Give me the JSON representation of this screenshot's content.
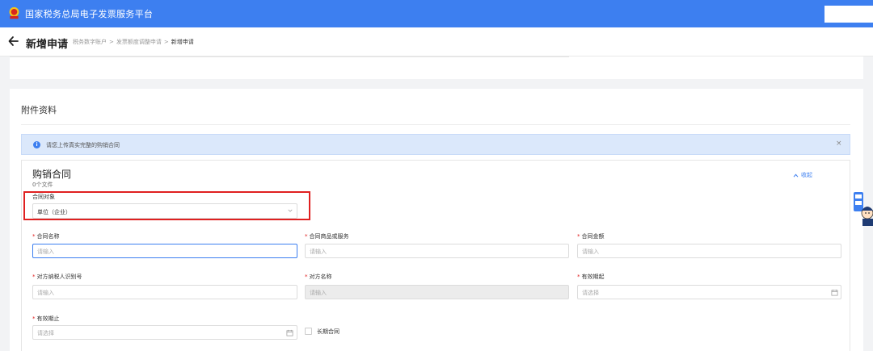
{
  "header": {
    "app_title": "国家税务总局电子发票服务平台"
  },
  "pagebar": {
    "title": "新增申请",
    "breadcrumb": [
      "税务数字账户",
      "发票额度调整申请",
      "新增申请"
    ],
    "separator": ">"
  },
  "section": {
    "title": "附件资料",
    "alert": {
      "text": "请您上传真实完整的购销合同",
      "close": "×"
    }
  },
  "contract": {
    "title": "购销合同",
    "file_count": "0个文件",
    "collapse_label": "收起",
    "object_label": "合同对象",
    "object_value": "单位（企业）"
  },
  "form": {
    "required_mark": "*",
    "name_label": "合同名称",
    "name_placeholder": "请输入",
    "goods_label": "合同商品或服务",
    "goods_placeholder": "请输入",
    "amount_label": "合同金额",
    "amount_placeholder": "请输入",
    "taxid_label": "对方纳税人识别号",
    "taxid_placeholder": "请输入",
    "party_label": "对方名称",
    "party_placeholder": "请输入",
    "start_label": "有效期起",
    "start_placeholder": "请选择",
    "end_label": "有效期止",
    "end_placeholder": "请选择",
    "longterm_label": "长期合同"
  },
  "colors": {
    "primary": "#3d7ff0",
    "required": "#e02020",
    "alert_bg": "#dbe8fb",
    "highlight": "#e02020"
  },
  "icons": [
    "emblem-logo",
    "back-arrow-icon",
    "info-icon",
    "close-icon",
    "chevron-up-icon",
    "chevron-down-icon",
    "calendar-icon",
    "mascot-icon"
  ]
}
